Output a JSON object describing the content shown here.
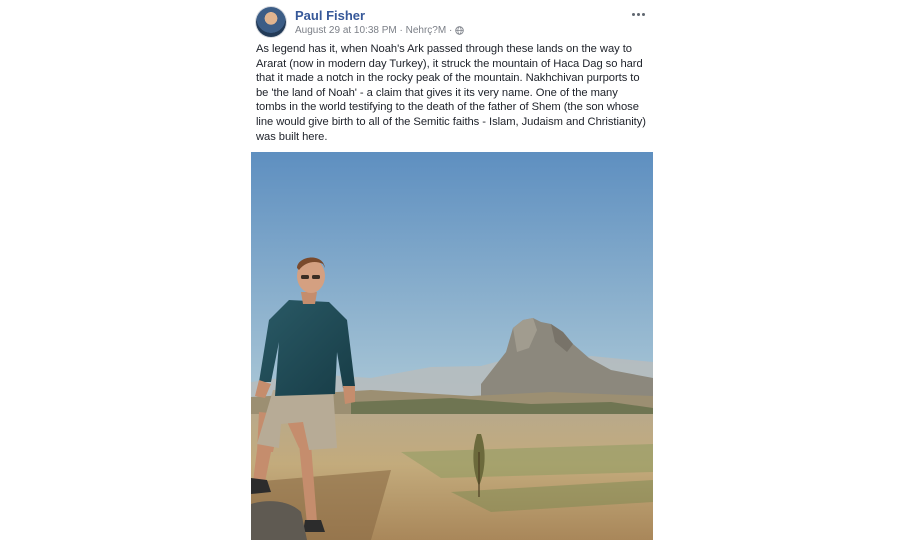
{
  "post": {
    "author_name": "Paul Fisher",
    "meta_text": "August 29 at 10:38 PM · Nehrç?M ·",
    "privacy_icon": "globe-icon",
    "more_icon": "more-options-icon",
    "body": "As legend has it, when Noah's Ark passed through these lands on the way to Ararat (now in modern day Turkey), it struck the mountain of Haca Dag so hard that it made a notch in the rocky peak of the mountain. Nakhchivan purports to be 'the land of Noah' - a claim that gives it its very name. One of the many tombs in the world testifying to the death of the father of Shem (the son whose line would give birth to all of the Semitic faiths - Islam, Judaism and Christianity) was built here."
  },
  "colors": {
    "author_link": "#365899",
    "meta_gray": "#7b7f87",
    "body_text": "#1d2129",
    "sky_top": "#5d8fc1",
    "sky_bottom": "#c8d8de",
    "mountain": "#8a8578",
    "plain": "#b9a47a"
  }
}
